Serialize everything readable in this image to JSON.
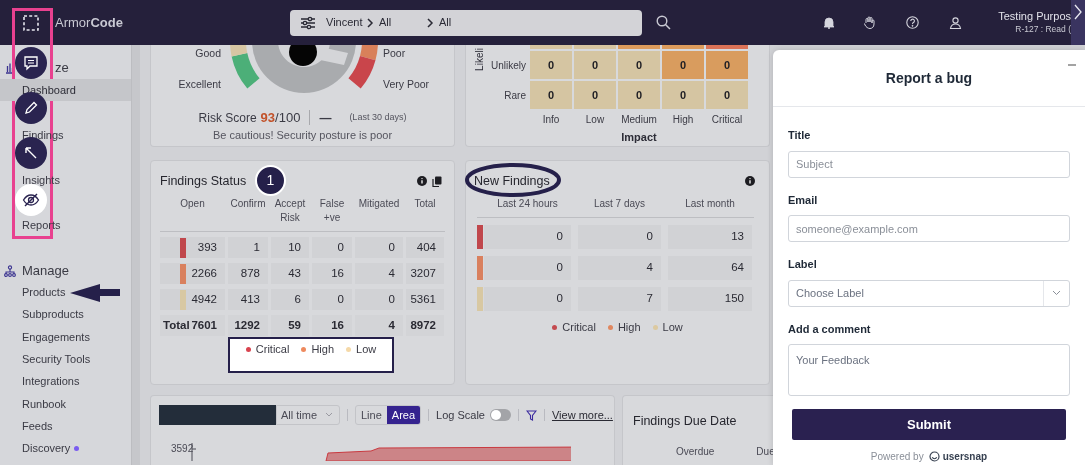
{
  "top_bar": {
    "logo_text": "Armor**Code**",
    "scope": {
      "org": "Vincent",
      "crumbs": [
        "All",
        "All"
      ]
    },
    "user": {
      "name": "Testing Purpos",
      "role": "R-127 : Read ("
    }
  },
  "sidebar": {
    "sections": [
      {
        "title": "ze",
        "items": [
          {
            "label": "Dashboard",
            "selected": true,
            "new": false
          },
          {
            "label": "Findings",
            "selected": false,
            "new": false
          },
          {
            "label": "Insights",
            "selected": false,
            "new": false
          },
          {
            "label": "Reports",
            "selected": false,
            "new": false
          }
        ]
      },
      {
        "title": "Manage",
        "items": [
          {
            "label": "Products",
            "selected": false,
            "new": false
          },
          {
            "label": "Subproducts",
            "selected": false,
            "new": false
          },
          {
            "label": "Engagements",
            "selected": false,
            "new": false
          },
          {
            "label": "Security Tools",
            "selected": false,
            "new": false
          },
          {
            "label": "Integrations",
            "selected": false,
            "new": false
          },
          {
            "label": "Runbook",
            "selected": false,
            "new": false
          },
          {
            "label": "Feeds",
            "selected": false,
            "new": false
          },
          {
            "label": "Discovery",
            "selected": false,
            "new": true
          }
        ]
      }
    ]
  },
  "risk_score": {
    "labels_left": [
      "Good",
      "Excellent"
    ],
    "labels_right": [
      "Poor",
      "Very Poor"
    ],
    "label": "Risk Score",
    "score": "93",
    "max": "/100",
    "trend": "—",
    "period": "(Last 30 days)",
    "message": "Be cautious! Security posture is poor"
  },
  "risk_matrix": {
    "y_label": "Likeli",
    "top_strip": [
      {
        "color": "#d6c4a0"
      },
      {
        "color": "#d6c4a0"
      },
      {
        "color": "#dc9b5c"
      },
      {
        "color": "#dc9b5c"
      },
      {
        "color": "#db7257"
      }
    ],
    "rows": [
      {
        "label": "Unlikely",
        "cells": [
          {
            "value": "0",
            "color": "#d5c5a2"
          },
          {
            "value": "0",
            "color": "#d5c5a2"
          },
          {
            "value": "0",
            "color": "#d5c5a2"
          },
          {
            "value": "0",
            "color": "#d99c5e"
          },
          {
            "value": "0",
            "color": "#d99c5e"
          }
        ]
      },
      {
        "label": "Rare",
        "cells": [
          {
            "value": "0",
            "color": "#d5c5a2"
          },
          {
            "value": "0",
            "color": "#d5c5a2"
          },
          {
            "value": "0",
            "color": "#d5c5a2"
          },
          {
            "value": "0",
            "color": "#d5c5a2"
          },
          {
            "value": "0",
            "color": "#d5c5a2"
          }
        ]
      }
    ],
    "x_ticks": [
      "Info",
      "Low",
      "Medium",
      "High",
      "Critical"
    ],
    "x_label": "Impact"
  },
  "findings_status": {
    "title": "Findings Status",
    "columns": [
      "Open",
      "Confirm",
      "Accept Risk",
      "False +ve",
      "Mitigated",
      "Total"
    ],
    "rows": [
      {
        "color": "#c0474c",
        "values": [
          "393",
          "1",
          "10",
          "0",
          "0",
          "404"
        ]
      },
      {
        "color": "#d9805e",
        "values": [
          "2266",
          "878",
          "43",
          "16",
          "4",
          "3207"
        ]
      },
      {
        "color": "#d8c8a2",
        "values": [
          "4942",
          "413",
          "6",
          "0",
          "0",
          "5361"
        ]
      }
    ],
    "total": {
      "label": "Total",
      "values": [
        "7601",
        "1292",
        "59",
        "16",
        "4",
        "8972"
      ]
    },
    "legend": [
      {
        "label": "Critical",
        "color": "#d9434f"
      },
      {
        "label": "High",
        "color": "#ee8a5e"
      },
      {
        "label": "Low",
        "color": "#f5d9a8"
      }
    ]
  },
  "new_findings": {
    "title": "New Findings",
    "columns": [
      "Last 24 hours",
      "Last 7 days",
      "Last month"
    ],
    "rows": [
      {
        "color": "#c0474c",
        "values": [
          "0",
          "0",
          "13"
        ]
      },
      {
        "color": "#d9805e",
        "values": [
          "0",
          "4",
          "64"
        ]
      },
      {
        "color": "#d8c8a2",
        "values": [
          "0",
          "7",
          "150"
        ]
      }
    ],
    "legend": [
      {
        "label": "Critical",
        "color": "#c44a4f"
      },
      {
        "label": "High",
        "color": "#e0875f"
      },
      {
        "label": "Low",
        "color": "#dcc9a0"
      }
    ]
  },
  "trend_chart": {
    "range": "All time",
    "modes": [
      {
        "label": "Line",
        "selected": false
      },
      {
        "label": "Area",
        "selected": true
      }
    ],
    "log_scale": {
      "label": "Log Scale",
      "on": false
    },
    "link": "View more...",
    "y_tick": "3592"
  },
  "due_date": {
    "title": "Findings Due Date",
    "columns": [
      "Overdue",
      "Due"
    ]
  },
  "annotations": {
    "step_badge": "1"
  },
  "bug_report": {
    "title": "Report a bug",
    "fields": [
      {
        "kind": "input",
        "label": "Title",
        "placeholder": "Subject"
      },
      {
        "kind": "input",
        "label": "Email",
        "placeholder": "someone@example.com"
      },
      {
        "kind": "select",
        "label": "Label",
        "placeholder": "Choose Label"
      },
      {
        "kind": "textarea",
        "label": "Add a comment",
        "placeholder": "Your Feedback"
      }
    ],
    "submit": "Submit",
    "powered_by": "Powered by",
    "brand": "usersnap"
  }
}
